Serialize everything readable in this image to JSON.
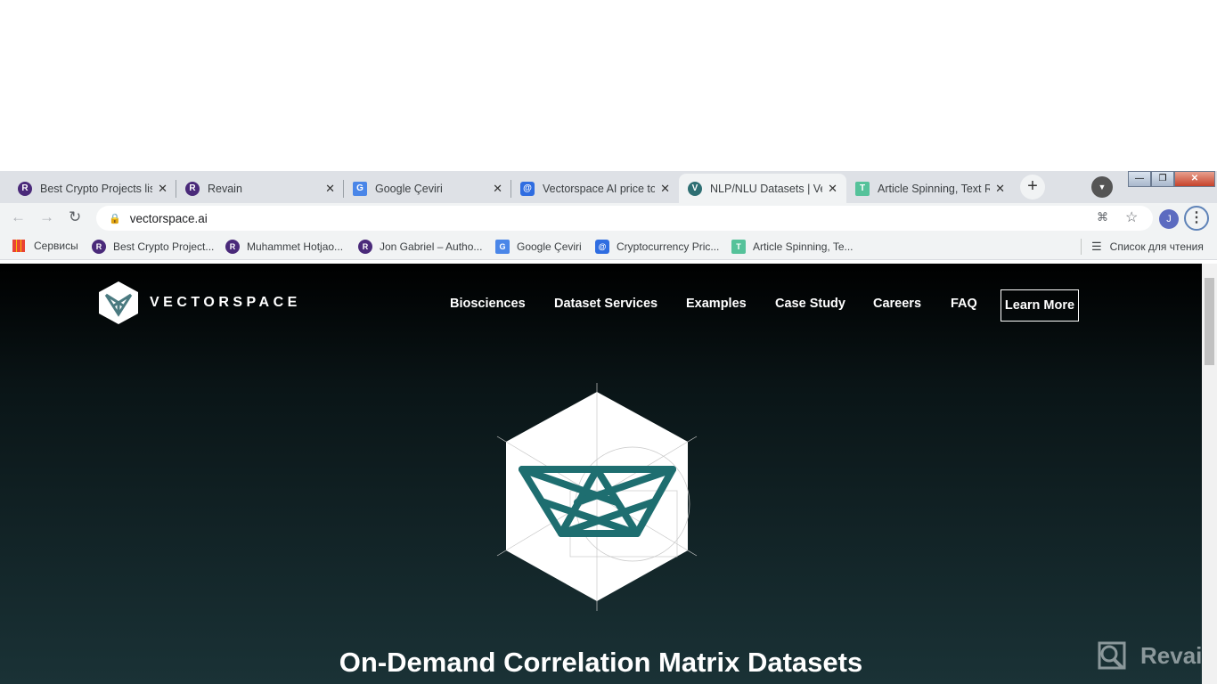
{
  "browser": {
    "tabs": [
      {
        "title": "Best Crypto Projects list",
        "favicon": "R",
        "color": "#4a2a7a"
      },
      {
        "title": "Revain",
        "favicon": "R",
        "color": "#4a2a7a"
      },
      {
        "title": "Google Çeviri",
        "favicon": "G",
        "color": "#4a86e8"
      },
      {
        "title": "Vectorspace AI price to",
        "favicon": "@",
        "color": "#2f6de1"
      },
      {
        "title": "NLP/NLU Datasets | Vectorspace",
        "favicon": "V",
        "color": "#2e6f73",
        "active": true
      },
      {
        "title": "Article Spinning, Text Rewriter",
        "favicon": "T",
        "color": "#55c29a"
      }
    ],
    "new_tab": "+",
    "url": "vectorspace.ai",
    "profile_initial": "J",
    "bookmarks": [
      {
        "label": "Сервисы",
        "icon": "apps-grid-icon"
      },
      {
        "label": "Best Crypto Project...",
        "favicon": "R",
        "color": "#4a2a7a"
      },
      {
        "label": "Muhammet Hotjao...",
        "favicon": "R",
        "color": "#4a2a7a"
      },
      {
        "label": "Jon Gabriel – Autho...",
        "favicon": "R",
        "color": "#4a2a7a"
      },
      {
        "label": "Google Çeviri",
        "favicon": "G",
        "color": "#4a86e8"
      },
      {
        "label": "Cryptocurrency Pric...",
        "favicon": "@",
        "color": "#2f6de1"
      },
      {
        "label": "Article Spinning, Te...",
        "favicon": "T",
        "color": "#55c29a"
      }
    ],
    "reading_list": "Список для чтения"
  },
  "site": {
    "logo_text": "VECTORSPACE",
    "nav": [
      "Biosciences",
      "Dataset Services",
      "Examples",
      "Case Study",
      "Careers",
      "FAQ"
    ],
    "cta": "Learn More",
    "hero_title": "On-Demand Correlation Matrix Datasets",
    "accent": "#1e6e70"
  },
  "watermark": "Revain"
}
